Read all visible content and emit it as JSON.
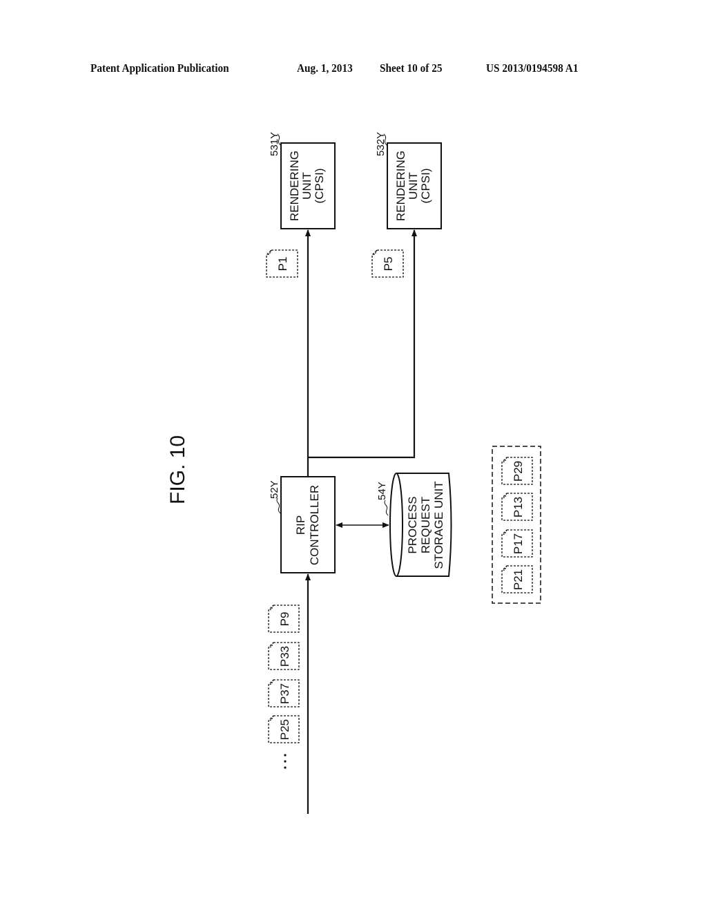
{
  "header": {
    "publication": "Patent Application Publication",
    "date": "Aug. 1, 2013",
    "sheet": "Sheet 10 of 25",
    "number": "US 2013/0194598 A1"
  },
  "figure": {
    "title": "FIG. 10",
    "rendering_units": [
      {
        "ref": "531Y",
        "lines": [
          "RENDERING",
          "UNIT",
          "(CPSI)"
        ],
        "incoming_page": "P1"
      },
      {
        "ref": "532Y",
        "lines": [
          "RENDERING",
          "UNIT",
          "(CPSI)"
        ],
        "incoming_page": "P5"
      }
    ],
    "rip_controller": {
      "ref": "52Y",
      "lines": [
        "RIP",
        "CONTROLLER"
      ]
    },
    "storage": {
      "ref": "54Y",
      "lines": [
        "PROCESS",
        "REQUEST",
        "STORAGE UNIT"
      ]
    },
    "input_queue": {
      "pages": [
        "P9",
        "P33",
        "P37",
        "P25"
      ],
      "ellipsis": "…"
    },
    "stored_requests": {
      "pages": [
        "P29",
        "P13",
        "P17",
        "P21"
      ]
    }
  }
}
